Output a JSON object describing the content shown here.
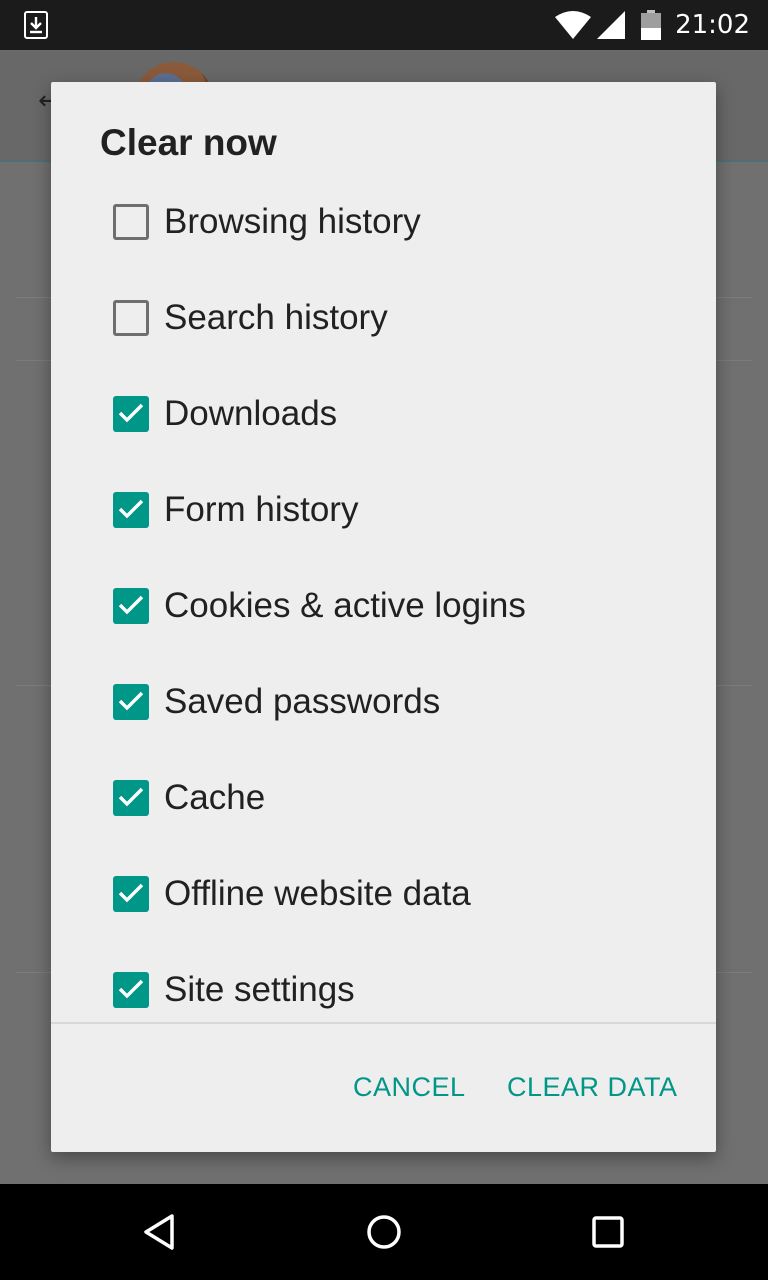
{
  "status_bar": {
    "time": "21:02",
    "icons": [
      "download-icon",
      "wifi-icon",
      "signal-icon",
      "battery-icon"
    ]
  },
  "dialog": {
    "title": "Clear now",
    "options": [
      {
        "label": "Browsing history",
        "checked": false
      },
      {
        "label": "Search history",
        "checked": false
      },
      {
        "label": "Downloads",
        "checked": true
      },
      {
        "label": "Form history",
        "checked": true
      },
      {
        "label": "Cookies & active logins",
        "checked": true
      },
      {
        "label": "Saved passwords",
        "checked": true
      },
      {
        "label": "Cache",
        "checked": true
      },
      {
        "label": "Offline website data",
        "checked": true
      },
      {
        "label": "Site settings",
        "checked": true
      }
    ],
    "cancel_label": "CANCEL",
    "confirm_label": "CLEAR DATA"
  },
  "colors": {
    "accent": "#009688",
    "status_bar": "#1b1b1b",
    "dialog_bg": "#eeeeee",
    "nav_bar": "#000000"
  },
  "nav_bar": {
    "icons": [
      "back-icon",
      "home-icon",
      "recents-icon"
    ]
  }
}
